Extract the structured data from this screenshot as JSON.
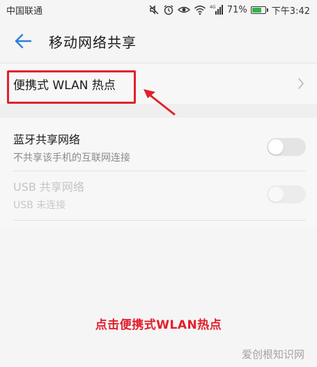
{
  "status_bar": {
    "carrier": "中国联通",
    "signal_tag": "4G",
    "battery_percent": "71%",
    "battery_level": 0.71,
    "time": "下午3:42",
    "icons": [
      "mute-icon",
      "alarm-icon",
      "eye-icon",
      "wifi-icon",
      "cell-signal-icon",
      "battery-icon"
    ]
  },
  "header": {
    "title": "移动网络共享",
    "back_icon": "back-arrow-icon"
  },
  "wlan_hotspot": {
    "label": "便携式 WLAN 热点",
    "chevron_icon": "chevron-right-icon"
  },
  "bluetooth_tethering": {
    "title": "蓝牙共享网络",
    "subtitle": "不共享该手机的互联网连接",
    "enabled": false
  },
  "usb_tethering": {
    "title": "USB 共享网络",
    "subtitle": "USB 未连接",
    "enabled": false,
    "disabled": true
  },
  "annotation": {
    "instruction": "点击便携式WLAN热点",
    "highlight_color": "#e2202c"
  },
  "watermark": {
    "text": "爱创根知识网"
  },
  "colors": {
    "accent": "#2f7fd8",
    "annotation": "#e2202c",
    "battery": "#33b34a"
  }
}
